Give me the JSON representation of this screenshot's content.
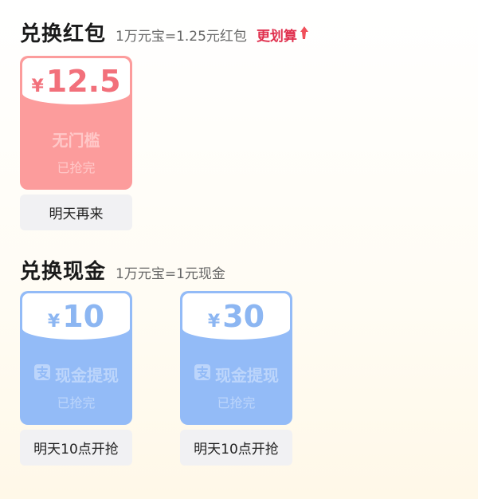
{
  "red_section": {
    "title": "兑换红包",
    "rate": "1万元宝=1.25元红包",
    "link_label": "更划算"
  },
  "red_cards": [
    {
      "currency": "¥",
      "amount": "12.5",
      "label": "无门槛",
      "status": "已抢完",
      "button": "明天再来"
    }
  ],
  "cash_section": {
    "title": "兑换现金",
    "rate": "1万元宝=1元现金"
  },
  "cash_cards": [
    {
      "currency": "¥",
      "amount": "10",
      "label": "现金提现",
      "status": "已抢完",
      "button": "明天10点开抢",
      "icon": "alipay-icon"
    },
    {
      "currency": "¥",
      "amount": "30",
      "label": "现金提现",
      "status": "已抢完",
      "button": "明天10点开抢",
      "icon": "alipay-icon"
    }
  ],
  "colors": {
    "red_card": "#fc9c9c",
    "blue_card": "#93bbf7",
    "accent_link": "#e0304e"
  }
}
